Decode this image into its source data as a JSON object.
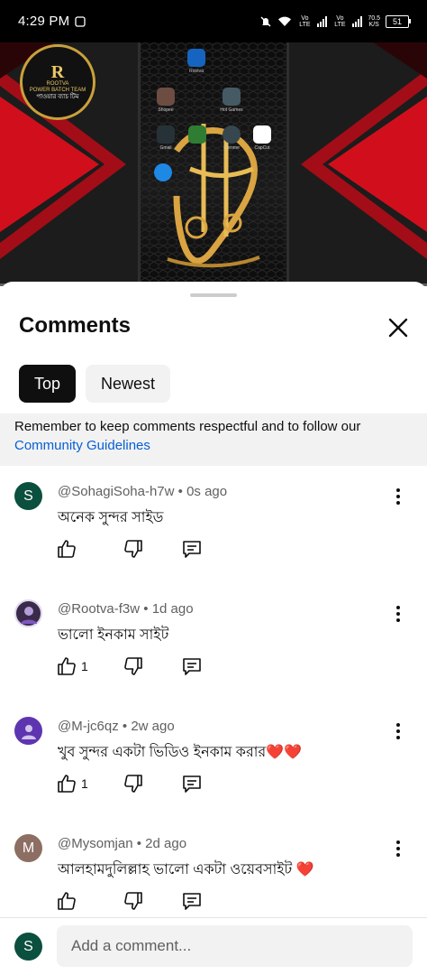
{
  "status_bar": {
    "time": "4:29 PM",
    "volte_1": "Vo LTE",
    "volte_2": "Vo LTE",
    "speed_value": "70.5",
    "speed_unit": "K/S",
    "battery": "51"
  },
  "video": {
    "channel_logo": {
      "letter": "R",
      "line1": "ROOTVA",
      "line2": "POWER BATCH TEAM",
      "line3": "পাওয়ার ব্যাচ টিম"
    },
    "apps": [
      "Rootva",
      "Shopee",
      "Hot Games",
      "Gmail",
      "Chrome",
      "CapCut"
    ]
  },
  "sheet": {
    "title": "Comments",
    "close_icon": "close-icon",
    "tabs": [
      {
        "label": "Top",
        "active": true
      },
      {
        "label": "Newest",
        "active": false
      }
    ],
    "notice_text": "Remember to keep comments respectful and to follow our",
    "notice_link": "Community Guidelines"
  },
  "comments": [
    {
      "avatar_letter": "S",
      "avatar_color": "#0b4f3e",
      "author": "@SohagiSoha-h7w",
      "time": "0s ago",
      "text": "অনেক সুন্দর সাইড",
      "likes": ""
    },
    {
      "avatar_letter": "",
      "avatar_color": "#3a2a4a",
      "author": "@Rootva-f3w",
      "time": "1d ago",
      "text": "ভালো ইনকাম সাইট",
      "likes": "1"
    },
    {
      "avatar_letter": "",
      "avatar_color": "#5e35b1",
      "author": "@M-jc6qz",
      "time": "2w ago",
      "text": "খুব সুন্দর একটা ভিডিও ইনকাম করার❤️❤️",
      "likes": "1"
    },
    {
      "avatar_letter": "M",
      "avatar_color": "#8d6e63",
      "author": "@Mysomjan",
      "time": "2d ago",
      "text": "আলহামদুলিল্লাহ ভালো একটা ওয়েবসাইট ❤️",
      "likes": ""
    }
  ],
  "composer": {
    "avatar_letter": "S",
    "placeholder": "Add a comment..."
  },
  "colors": {
    "link": "#065fd4",
    "chip_active_bg": "#0f0f0f",
    "chip_inactive_bg": "#f2f2f2",
    "video_accent": "#d10f1c"
  }
}
